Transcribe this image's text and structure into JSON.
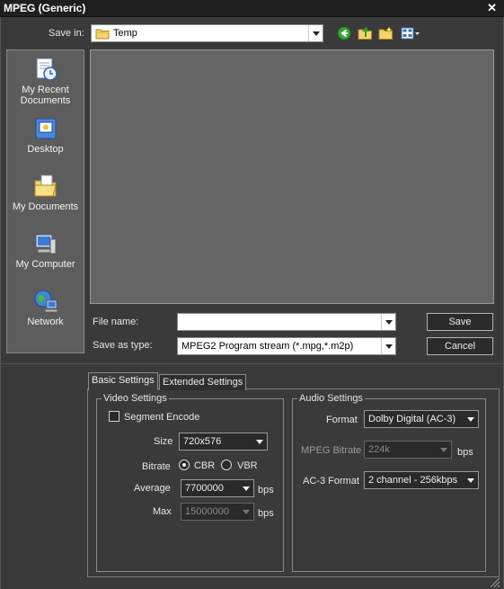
{
  "window": {
    "title": "MPEG (Generic)",
    "close_glyph": "✕"
  },
  "save_in": {
    "label": "Save in:",
    "value": "Temp",
    "icon": "folder-icon"
  },
  "toolbar_icons": [
    "back-icon",
    "up-folder-icon",
    "new-folder-icon",
    "view-menu-icon"
  ],
  "places": [
    {
      "label1": "My Recent",
      "label2": "Documents",
      "icon": "recent-documents-icon"
    },
    {
      "label1": "Desktop",
      "label2": "",
      "icon": "desktop-icon"
    },
    {
      "label1": "My Documents",
      "label2": "",
      "icon": "my-documents-icon"
    },
    {
      "label1": "My Computer",
      "label2": "",
      "icon": "my-computer-icon"
    },
    {
      "label1": "Network",
      "label2": "",
      "icon": "network-icon"
    }
  ],
  "file_name": {
    "label": "File name:",
    "value": ""
  },
  "save_as_type": {
    "label": "Save as type:",
    "value": "MPEG2 Program stream (*.mpg,*.m2p)"
  },
  "buttons": {
    "save": "Save",
    "cancel": "Cancel"
  },
  "tabs": [
    {
      "label": "Basic Settings",
      "active": true
    },
    {
      "label": "Extended Settings",
      "active": false
    }
  ],
  "video": {
    "group_label": "Video Settings",
    "segment_encode": {
      "label": "Segment Encode",
      "checked": false
    },
    "size": {
      "label": "Size",
      "value": "720x576"
    },
    "bitrate": {
      "label": "Bitrate",
      "cbr": "CBR",
      "vbr": "VBR",
      "selected": "CBR"
    },
    "average": {
      "label": "Average",
      "value": "7700000",
      "unit": "bps"
    },
    "max": {
      "label": "Max",
      "value": "15000000",
      "unit": "bps"
    }
  },
  "audio": {
    "group_label": "Audio Settings",
    "format": {
      "label": "Format",
      "value": "Dolby Digital (AC-3)"
    },
    "mpeg_bitrate": {
      "label": "MPEG Bitrate",
      "value": "224k",
      "unit": "bps"
    },
    "ac3_format": {
      "label": "AC-3 Format",
      "value": "2 channel - 256kbps"
    }
  },
  "colors": {
    "background": "#3a3a3a",
    "titlebar": "#1f1f1f",
    "file_list": "#656565",
    "places_bar": "#5d5d5d"
  }
}
